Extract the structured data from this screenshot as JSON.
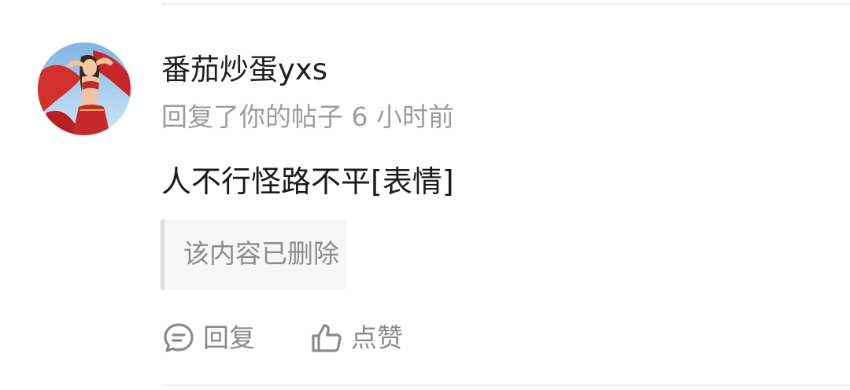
{
  "user": {
    "name": "番茄炒蛋yxs",
    "avatar_icon": "user-avatar"
  },
  "notification": {
    "meta": "回复了你的帖子 6 小时前"
  },
  "comment": {
    "text": "人不行怪路不平[表情]"
  },
  "quoted": {
    "text": "该内容已删除"
  },
  "actions": {
    "reply_label": "回复",
    "reply_icon": "comment-bubble-icon",
    "like_label": "点赞",
    "like_icon": "thumbs-up-icon"
  },
  "colors": {
    "primary_text": "#1a1a1a",
    "secondary_text": "#9c9c9c",
    "action_gray": "#8a8a8a",
    "quote_bg": "#f7f7f7",
    "quote_border": "#dedede"
  }
}
